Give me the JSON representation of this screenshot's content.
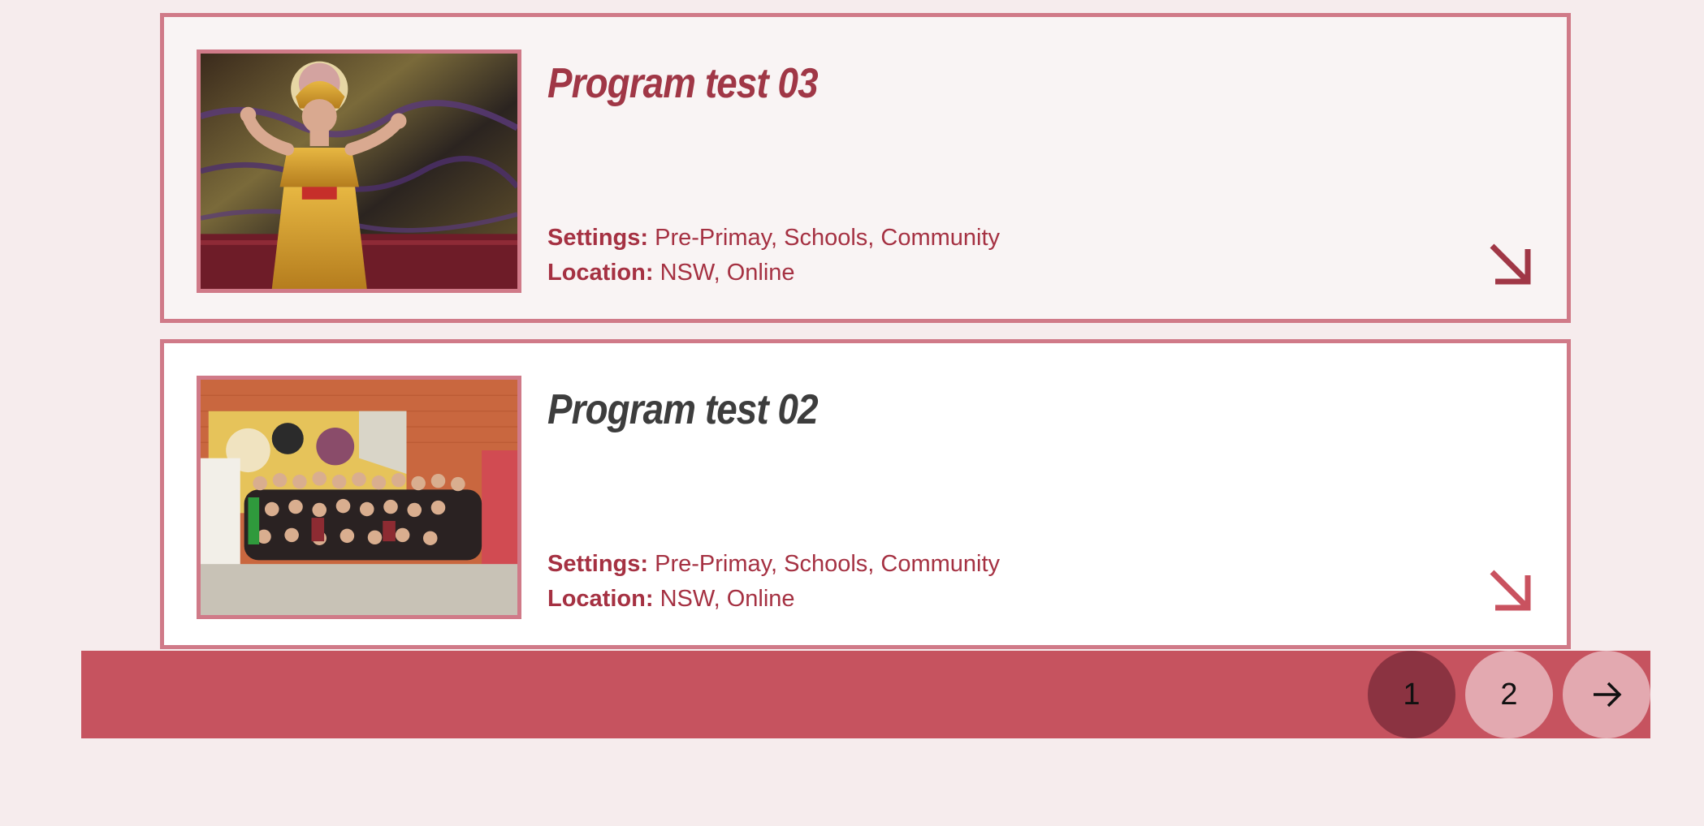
{
  "programs": [
    {
      "title": "Program test 03",
      "settings_label": "Settings:",
      "settings_value": "Pre-Primay, Schools, Community",
      "location_label": "Location:",
      "location_value": "NSW, Online",
      "image_icon": "dancer-photo",
      "link_icon": "arrow-down-right-icon"
    },
    {
      "title": "Program test 02",
      "settings_label": "Settings:",
      "settings_value": "Pre-Primay, Schools, Community",
      "location_label": "Location:",
      "location_value": "NSW, Online",
      "image_icon": "group-photo",
      "link_icon": "arrow-down-right-icon"
    }
  ],
  "pagination": {
    "pages": [
      "1",
      "2"
    ],
    "current": "1",
    "next_icon": "arrow-right-icon"
  },
  "colors": {
    "accent": "#a03746",
    "card_border": "#d07a88",
    "pager_bar": "#c6535f",
    "page_active": "#8b3341",
    "page_inactive": "#e3a9b0",
    "background": "#f6eced"
  }
}
